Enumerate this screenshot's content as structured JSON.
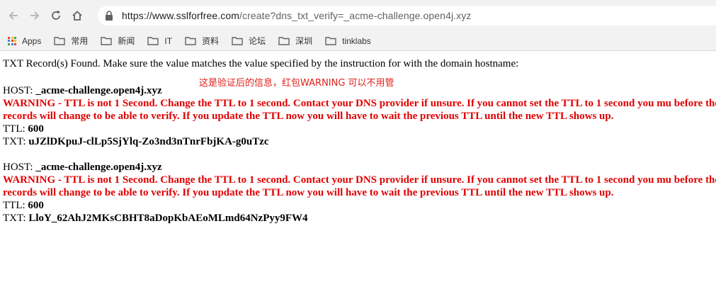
{
  "browser": {
    "url_host": "https://www.sslforfree.com",
    "url_rest": "/create?dns_txt_verify=_acme-challenge.open4j.xyz"
  },
  "bookmarks": [
    {
      "label": "Apps",
      "icon": "apps-grid-icon"
    },
    {
      "label": "常用",
      "icon": "folder-icon"
    },
    {
      "label": "新闻",
      "icon": "folder-icon"
    },
    {
      "label": "IT",
      "icon": "folder-icon"
    },
    {
      "label": "资料",
      "icon": "folder-icon"
    },
    {
      "label": "论坛",
      "icon": "folder-icon"
    },
    {
      "label": "深圳",
      "icon": "folder-icon"
    },
    {
      "label": "tinklabs",
      "icon": "folder-icon"
    }
  ],
  "page": {
    "intro": "TXT Record(s) Found. Make sure the value matches the value specified by the instruction for with the domain hostname:",
    "note": "这是验证后的信息，红包WARNING 可以不用管",
    "records": [
      {
        "host_label": "HOST:",
        "host": "_acme-challenge.open4j.xyz",
        "warning": "WARNING - TTL is not 1 Second. Change the TTL to 1 second. Contact your DNS provider if unsure. If you cannot set the TTL to 1 second you mu before the records will change to be able to verify. If you update the TTL now you will have to wait the previous TTL until the new TTL shows up.",
        "ttl_label": "TTL:",
        "ttl": "600",
        "txt_label": "TXT:",
        "txt": "uJZlDKpuJ-clLp5SjYlq-Zo3nd3nTnrFbjKA-g0uTzc"
      },
      {
        "host_label": "HOST:",
        "host": "_acme-challenge.open4j.xyz",
        "warning": "WARNING - TTL is not 1 Second. Change the TTL to 1 second. Contact your DNS provider if unsure. If you cannot set the TTL to 1 second you mu before the records will change to be able to verify. If you update the TTL now you will have to wait the previous TTL until the new TTL shows up.",
        "ttl_label": "TTL:",
        "ttl": "600",
        "txt_label": "TXT:",
        "txt": "LloY_62AhJ2MKsCBHT8aDopKbAEoMLmd64NzPyy9FW4"
      }
    ]
  }
}
